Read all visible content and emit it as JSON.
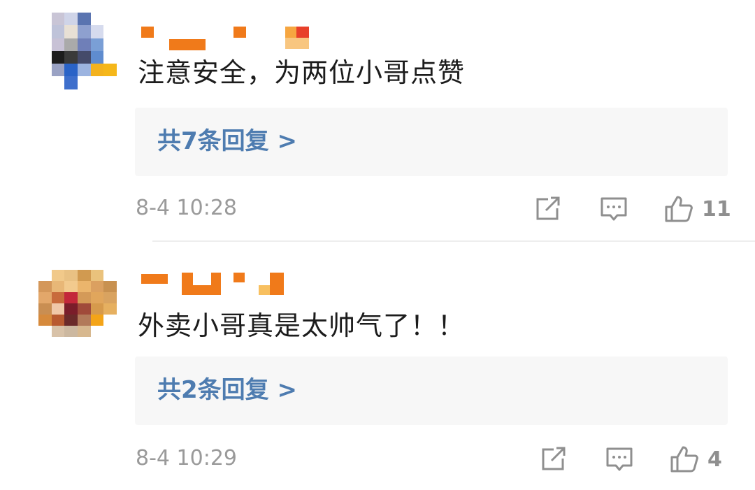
{
  "comments": [
    {
      "text": "注意安全，为两位小哥点赞",
      "reply_label": "共7条回复 >",
      "time": "8-4 10:28",
      "likes": "11",
      "icons": [
        "share-icon",
        "comment-icon",
        "thumbs-up-icon"
      ]
    },
    {
      "text": "外卖小哥真是太帅气了！！",
      "reply_label": "共2条回复 >",
      "time": "8-4 10:29",
      "likes": "4",
      "icons": [
        "share-icon",
        "comment-icon",
        "thumbs-up-icon"
      ]
    }
  ],
  "colors": {
    "reply_link": "#4e7cb0",
    "reply_bg": "#f7f7f7",
    "meta_gray": "#9a9a9a",
    "username_orange": "#f07a1a"
  }
}
